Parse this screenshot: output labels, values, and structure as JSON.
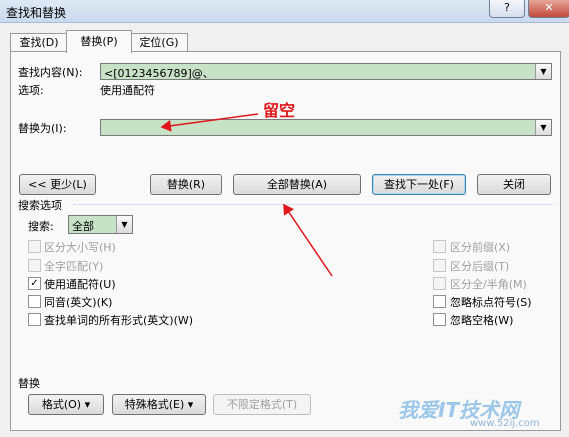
{
  "window": {
    "title": "查找和替换",
    "help_label": "?",
    "close_label": "✕"
  },
  "tabs": [
    {
      "label": "查找(D)"
    },
    {
      "label": "替换(P)"
    },
    {
      "label": "定位(G)"
    }
  ],
  "find": {
    "label": "查找内容(N):",
    "value": "<[0123456789]@、"
  },
  "options": {
    "label": "选项:",
    "value": "使用通配符"
  },
  "replace": {
    "label": "替换为(I):",
    "value": ""
  },
  "annotation": {
    "text": "留空"
  },
  "buttons": {
    "less": "<< 更少(L)",
    "replace": "替换(R)",
    "replace_all": "全部替换(A)",
    "find_next": "查找下一处(F)",
    "close": "关闭"
  },
  "search_options": {
    "heading": "搜索选项",
    "search_label": "搜索:",
    "search_value": "全部",
    "left": [
      {
        "label": "区分大小写(H)",
        "checked": false,
        "disabled": true
      },
      {
        "label": "全字匹配(Y)",
        "checked": false,
        "disabled": true
      },
      {
        "label": "使用通配符(U)",
        "checked": true,
        "disabled": false
      },
      {
        "label": "同音(英文)(K)",
        "checked": false,
        "disabled": false
      },
      {
        "label": "查找单词的所有形式(英文)(W)",
        "checked": false,
        "disabled": false
      }
    ],
    "right": [
      {
        "label": "区分前缀(X)",
        "checked": false,
        "disabled": true
      },
      {
        "label": "区分后缀(T)",
        "checked": false,
        "disabled": true
      },
      {
        "label": "区分全/半角(M)",
        "checked": false,
        "disabled": true
      },
      {
        "label": "忽略标点符号(S)",
        "checked": false,
        "disabled": false
      },
      {
        "label": "忽略空格(W)",
        "checked": false,
        "disabled": false
      }
    ]
  },
  "replace_section": {
    "heading": "替换",
    "format": "格式(O) ▾",
    "special": "特殊格式(E) ▾",
    "no_format": "不限定格式(T)"
  },
  "watermark": {
    "text": "我爱IT技术网",
    "url": "www.52ij.com"
  },
  "colors": {
    "field_bg": "#c8e2c8",
    "annotation": "#e0161a"
  }
}
